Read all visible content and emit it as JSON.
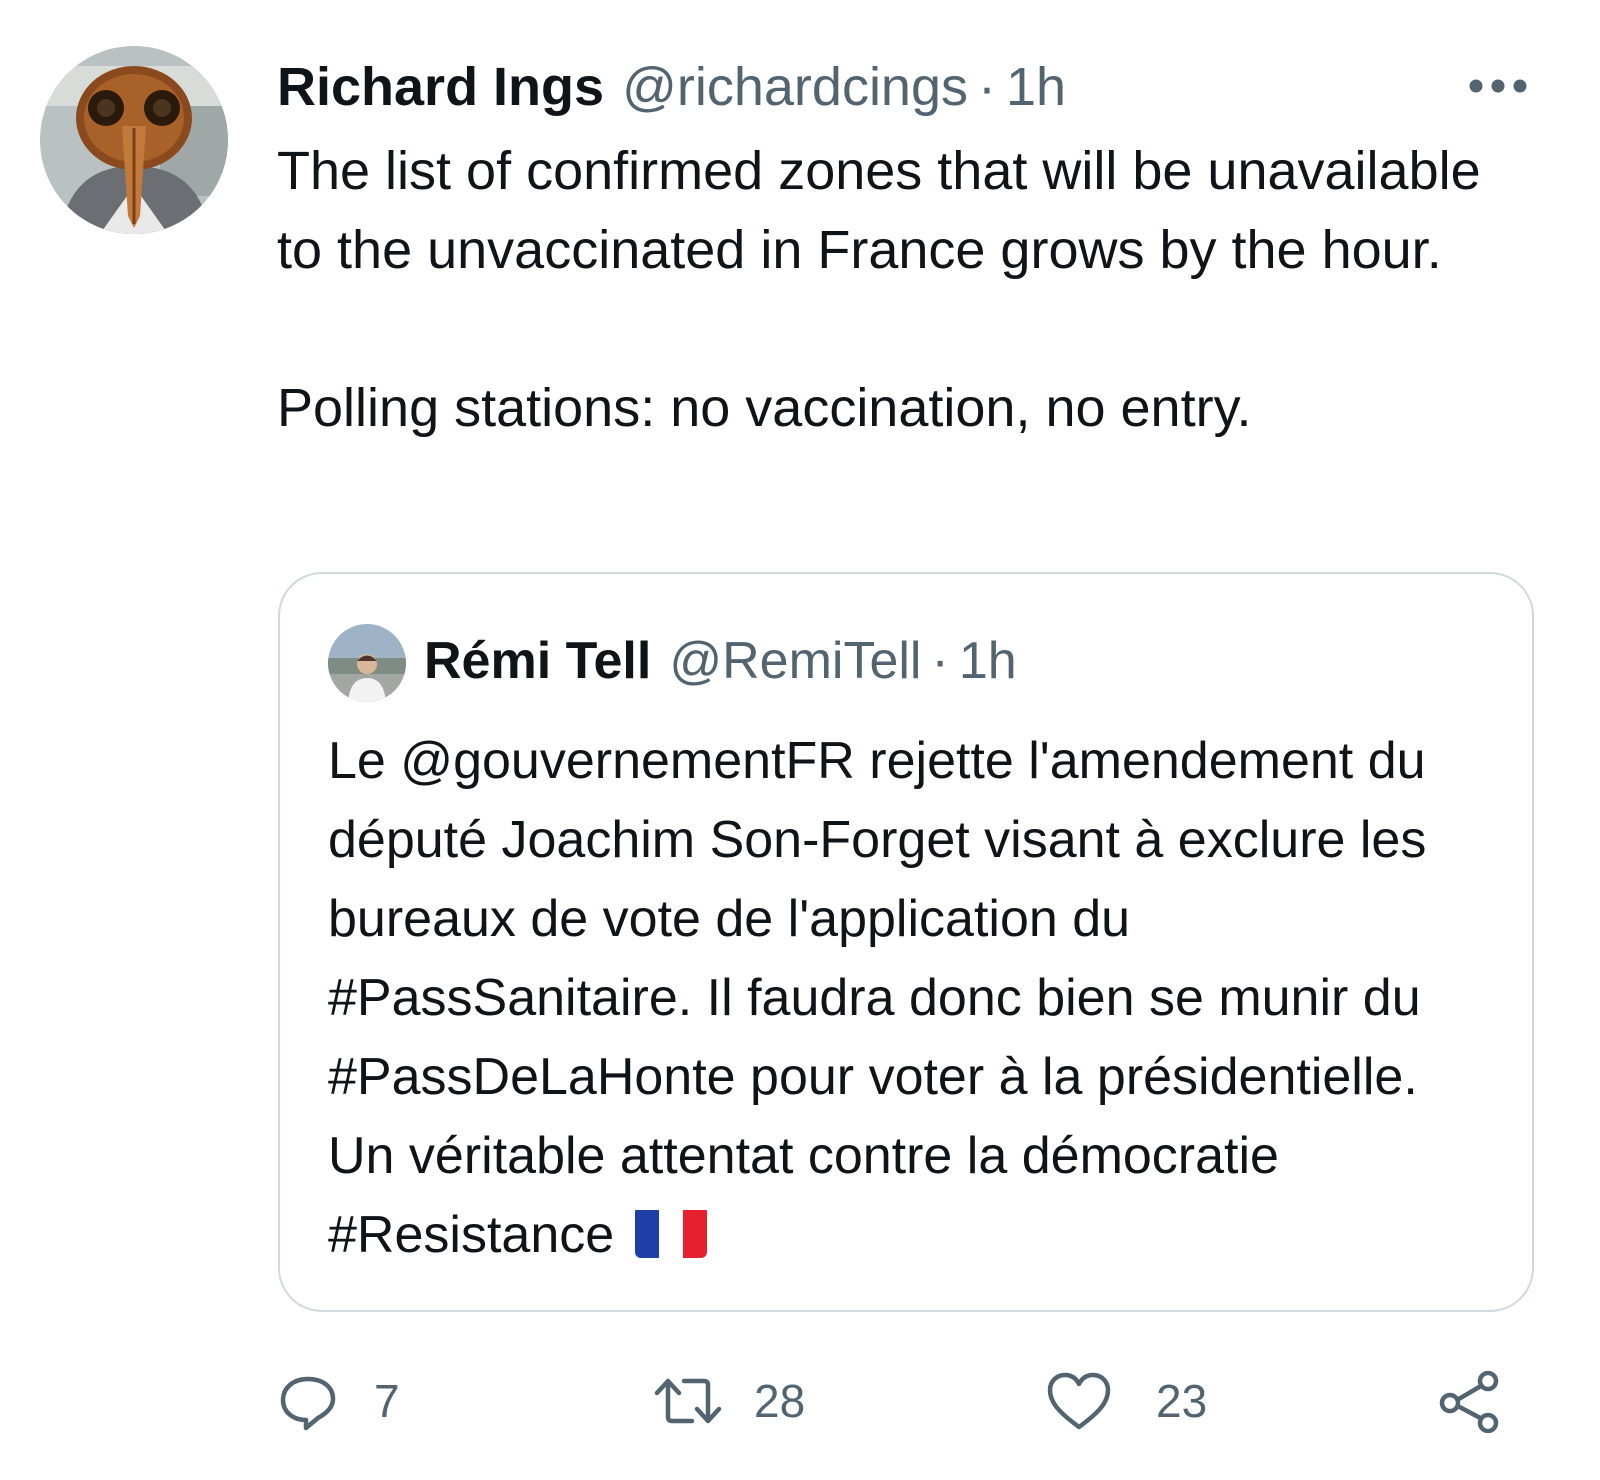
{
  "tweet": {
    "author_name": "Richard Ings",
    "author_handle": "@richardcings",
    "separator": "·",
    "time": "1h",
    "text": "The list of confirmed zones that will be unavailable to the unvaccinated in France grows by the hour.\n\nPolling stations: no vaccination, no entry."
  },
  "quote": {
    "author_name": "Rémi Tell",
    "author_handle": "@RemiTell",
    "separator": "·",
    "time": "1h",
    "text": "Le @gouvernementFR rejette l'amendement du député Joachim Son-Forget visant à exclure les bureaux de vote de l'application du #PassSanitaire. Il faudra donc bien se munir du #PassDeLaHonte pour voter à la présidentielle. Un véritable attentat contre la démocratie #Resistance",
    "flag_emoji": "france-flag"
  },
  "actions": {
    "reply_count": "7",
    "retweet_count": "28",
    "like_count": "23"
  },
  "icons": {
    "more": "more-icon",
    "reply": "reply-icon",
    "retweet": "retweet-icon",
    "like": "heart-icon",
    "share": "share-icon"
  },
  "colors": {
    "text": "#0f1419",
    "secondary": "#536471",
    "border": "#cfd9de",
    "flag_blue": "#1f3fa8",
    "flag_white": "#ffffff",
    "flag_red": "#e5212e"
  }
}
